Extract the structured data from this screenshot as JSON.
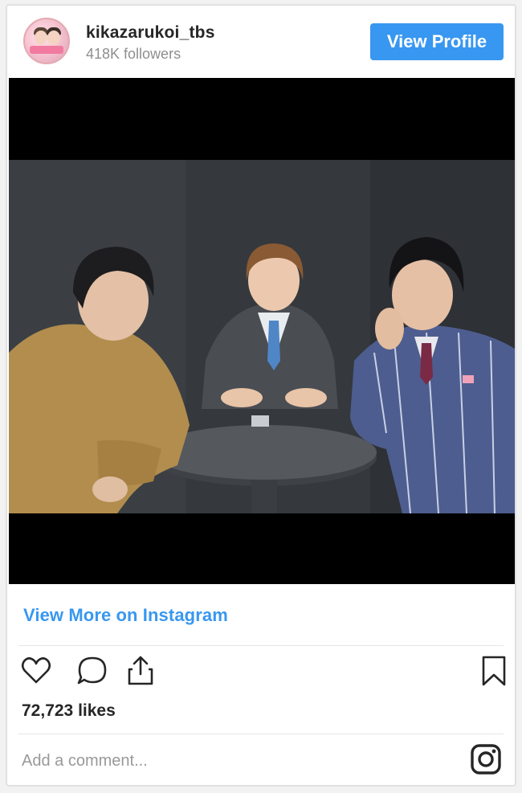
{
  "profile": {
    "username": "kikazarukoi_tbs",
    "followers": "418K followers",
    "view_profile_label": "View Profile"
  },
  "post": {
    "view_more_label": "View More on Instagram",
    "likes": "72,723 likes",
    "comment_placeholder": "Add a comment..."
  },
  "icons": {
    "like": "heart-icon",
    "comment": "comment-icon",
    "share": "share-icon",
    "save": "bookmark-icon",
    "brand": "instagram-icon"
  },
  "colors": {
    "accent": "#3897f0",
    "text": "#262626",
    "muted": "#8e8e8e"
  }
}
